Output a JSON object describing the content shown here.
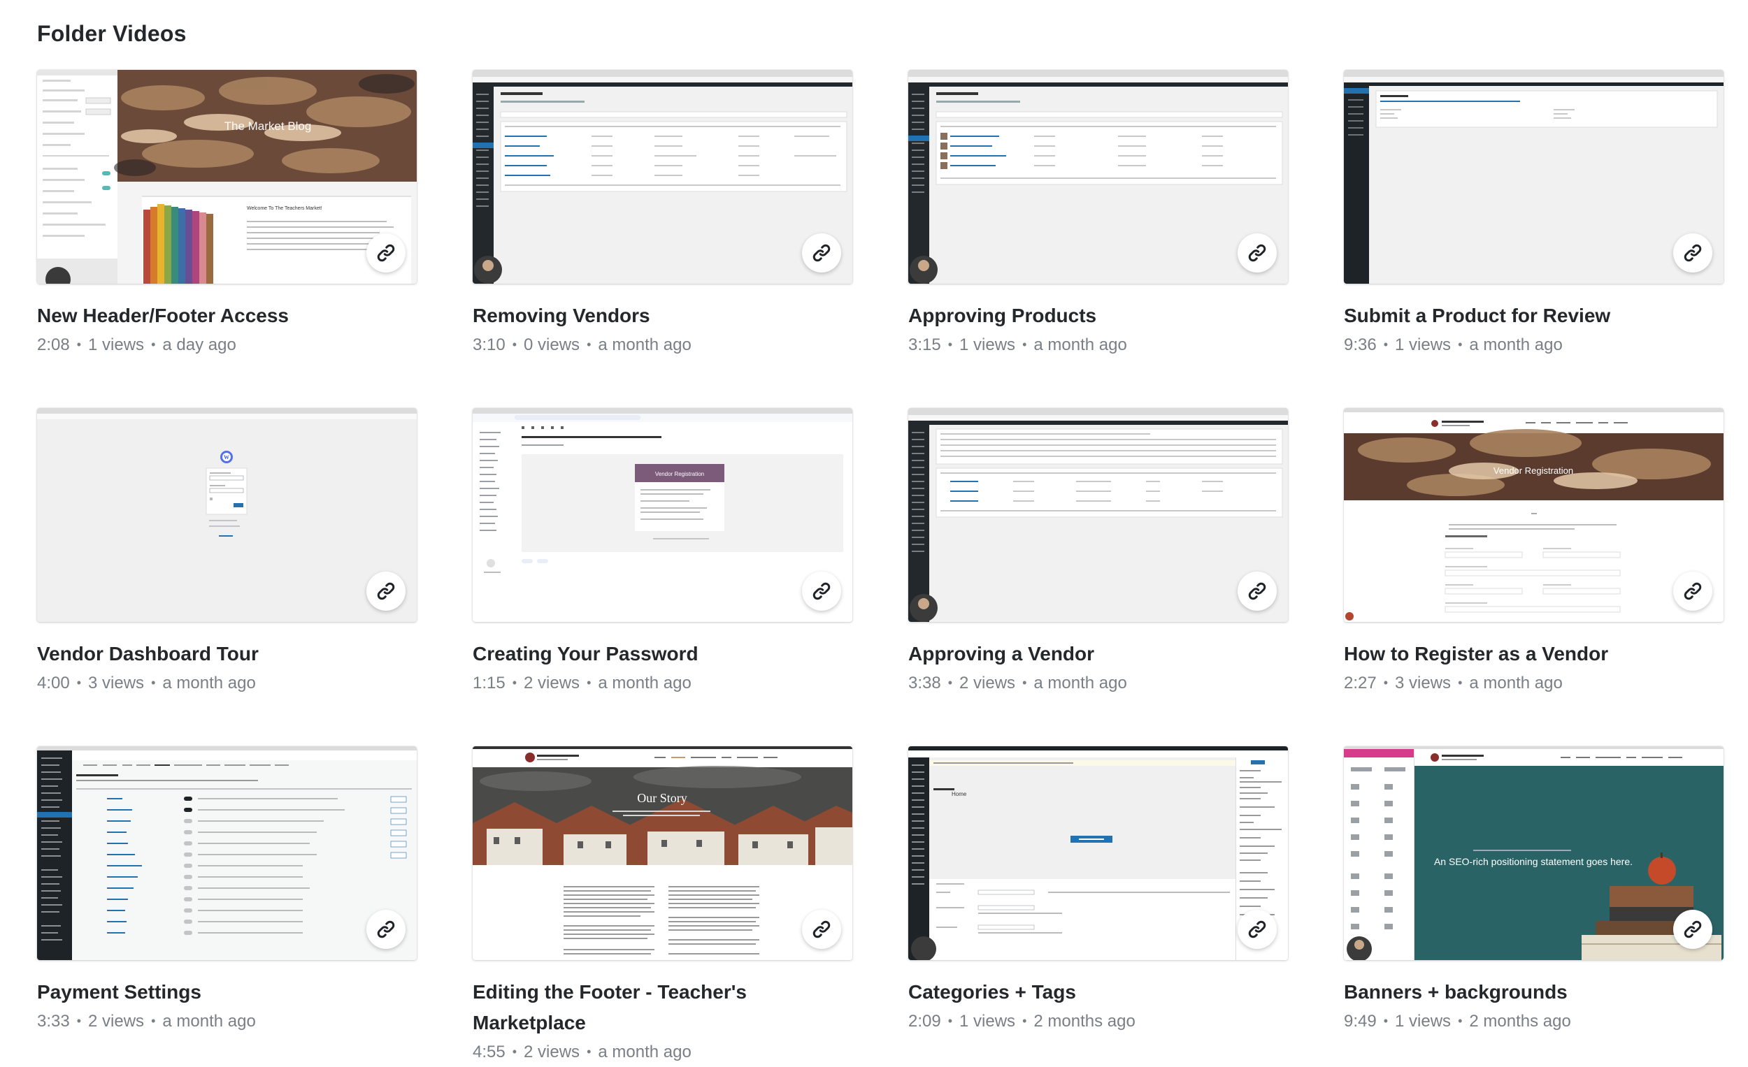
{
  "section": {
    "title": "Folder Videos"
  },
  "videos": [
    {
      "title": "New Header/Footer Access",
      "duration": "2:08",
      "views": "1 views",
      "age": "a day ago",
      "thumb_text": "The Market Blog",
      "thumb_style": "editor-blog"
    },
    {
      "title": "Removing Vendors",
      "duration": "3:10",
      "views": "0 views",
      "age": "a month ago",
      "thumb_text": "",
      "thumb_style": "wp-admin-table"
    },
    {
      "title": "Approving Products",
      "duration": "3:15",
      "views": "1 views",
      "age": "a month ago",
      "thumb_text": "",
      "thumb_style": "wp-admin-table"
    },
    {
      "title": "Submit a Product for Review",
      "duration": "9:36",
      "views": "1 views",
      "age": "a month ago",
      "thumb_text": "",
      "thumb_style": "wp-admin-blank"
    },
    {
      "title": "Vendor Dashboard Tour",
      "duration": "4:00",
      "views": "3 views",
      "age": "a month ago",
      "thumb_text": "",
      "thumb_style": "wp-login"
    },
    {
      "title": "Creating Your Password",
      "duration": "1:15",
      "views": "2 views",
      "age": "a month ago",
      "thumb_text": "Vendor Registration",
      "thumb_style": "gmail"
    },
    {
      "title": "Approving a Vendor",
      "duration": "3:38",
      "views": "2 views",
      "age": "a month ago",
      "thumb_text": "",
      "thumb_style": "wp-admin-table"
    },
    {
      "title": "How to Register as a Vendor",
      "duration": "2:27",
      "views": "3 views",
      "age": "a month ago",
      "thumb_text": "Vendor Registration",
      "thumb_style": "register-form"
    },
    {
      "title": "Payment Settings",
      "duration": "3:33",
      "views": "2 views",
      "age": "a month ago",
      "thumb_text": "",
      "thumb_style": "payments"
    },
    {
      "title": "Editing the Footer - Teacher's Marketplace",
      "duration": "4:55",
      "views": "2 views",
      "age": "a month ago",
      "thumb_text": "Our Story",
      "thumb_style": "story"
    },
    {
      "title": "Categories + Tags",
      "duration": "2:09",
      "views": "1 views",
      "age": "2 months ago",
      "thumb_text": "Home",
      "thumb_style": "page-editor"
    },
    {
      "title": "Banners + backgrounds",
      "duration": "9:49",
      "views": "1 views",
      "age": "2 months ago",
      "thumb_text": "An SEO-rich positioning statement goes here.",
      "thumb_style": "banner"
    }
  ],
  "colors": {
    "title_text": "#25282b",
    "meta_text": "#7a7f86",
    "wp_sidebar": "#23282d",
    "banner_teal": "#2f6f72",
    "register_purple": "#7b5a7a"
  },
  "icons": {
    "copy_link": "link-icon"
  }
}
